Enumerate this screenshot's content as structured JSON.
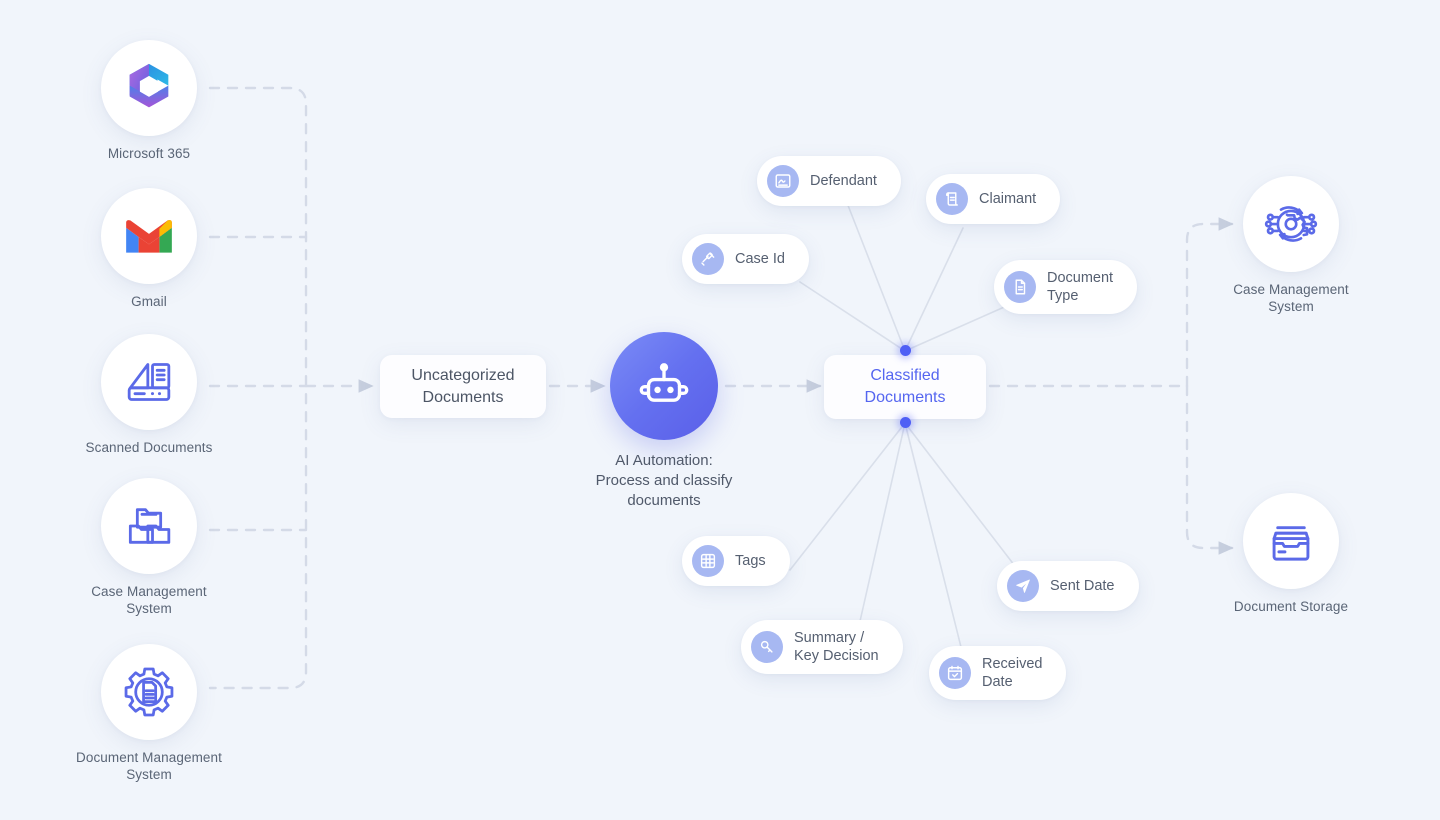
{
  "canvas": {
    "background": "#f1f5fb"
  },
  "colors": {
    "accent": "#5566f0",
    "icon_blue": "#5b6ae8",
    "pill_icon_bg": "#a7b8f2",
    "dot": "#4f5ff5",
    "edge": "#d3dae7",
    "text": "#5a6576"
  },
  "sources": [
    {
      "label": "Microsoft 365",
      "icon": "microsoft-365-icon"
    },
    {
      "label": "Gmail",
      "icon": "gmail-icon"
    },
    {
      "label": "Scanned Documents",
      "icon": "scanner-icon"
    },
    {
      "label": "Case Management\nSystem",
      "icon": "folders-icon"
    },
    {
      "label": "Document Management\nSystem",
      "icon": "gear-document-icon"
    }
  ],
  "process": {
    "input_card": "Uncategorized\nDocuments",
    "ai_node": {
      "icon": "robot-icon",
      "caption": "AI Automation:\nProcess and classify\ndocuments"
    },
    "output_card": "Classified\nDocuments"
  },
  "attributes": [
    {
      "label": "Defendant",
      "icon": "signature-icon"
    },
    {
      "label": "Claimant",
      "icon": "scroll-document-icon"
    },
    {
      "label": "Case Id",
      "icon": "gavel-icon"
    },
    {
      "label": "Document\nType",
      "icon": "file-icon"
    },
    {
      "label": "Tags",
      "icon": "hash-icon"
    },
    {
      "label": "Summary /\nKey Decision",
      "icon": "key-icon"
    },
    {
      "label": "Sent Date",
      "icon": "paper-plane-icon"
    },
    {
      "label": "Received\nDate",
      "icon": "calendar-check-icon"
    }
  ],
  "destinations": [
    {
      "label": "Case Management\nSystem",
      "icon": "ai-gear-network-icon"
    },
    {
      "label": "Document Storage",
      "icon": "archive-tray-icon"
    }
  ]
}
